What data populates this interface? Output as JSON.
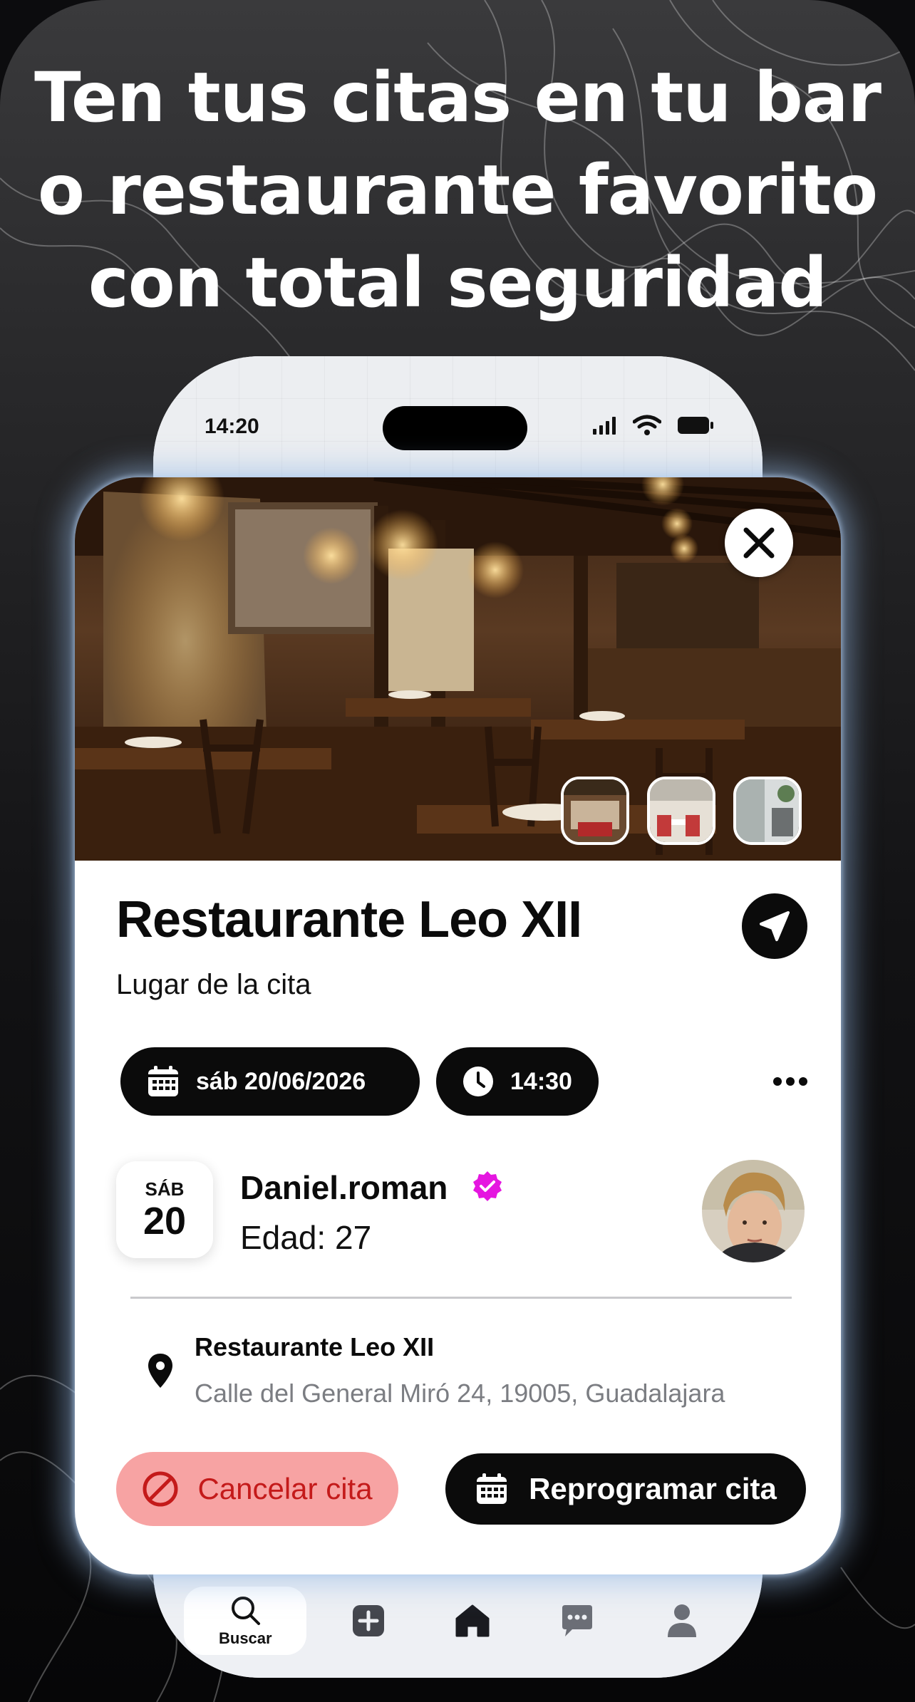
{
  "headline": {
    "line1": "Ten tus citas en tu bar",
    "line2": "o restaurante favorito",
    "line3": "con total seguridad"
  },
  "status_bar": {
    "time": "14:20",
    "icons": [
      "signal-icon",
      "wifi-icon",
      "battery-icon"
    ]
  },
  "venue": {
    "name": "Restaurante Leo XII",
    "subtitle": "Lugar de la cita",
    "photos": [
      "restaurant-interior-photo",
      "thumbnail-1",
      "thumbnail-2",
      "thumbnail-3"
    ]
  },
  "appointment": {
    "date": "sáb 20/06/2026",
    "time": "14:30",
    "day_of_week": "SÁB",
    "day_number": "20"
  },
  "user": {
    "name": "Daniel.roman",
    "age": "Edad: 27",
    "verified": true
  },
  "location": {
    "name": "Restaurante Leo XII",
    "address": "Calle del General Miró 24, 19005, Guadalajara"
  },
  "actions": {
    "cancel_label": "Cancelar cita",
    "reschedule_label": "Reprogramar cita"
  },
  "tabbar": {
    "items": [
      {
        "label": "Buscar",
        "icon": "search-icon",
        "active": true
      },
      {
        "label": "",
        "icon": "add-icon",
        "active": false
      },
      {
        "label": "",
        "icon": "home-icon",
        "active": false
      },
      {
        "label": "",
        "icon": "chat-icon",
        "active": false
      },
      {
        "label": "",
        "icon": "profile-icon",
        "active": false
      }
    ]
  },
  "colors": {
    "accent_black": "#0b0b0b",
    "cancel_bg": "#f7a3a3",
    "cancel_text": "#c41a1a",
    "verified_badge": "#e516e0",
    "card_glow": "#96b9e6"
  }
}
